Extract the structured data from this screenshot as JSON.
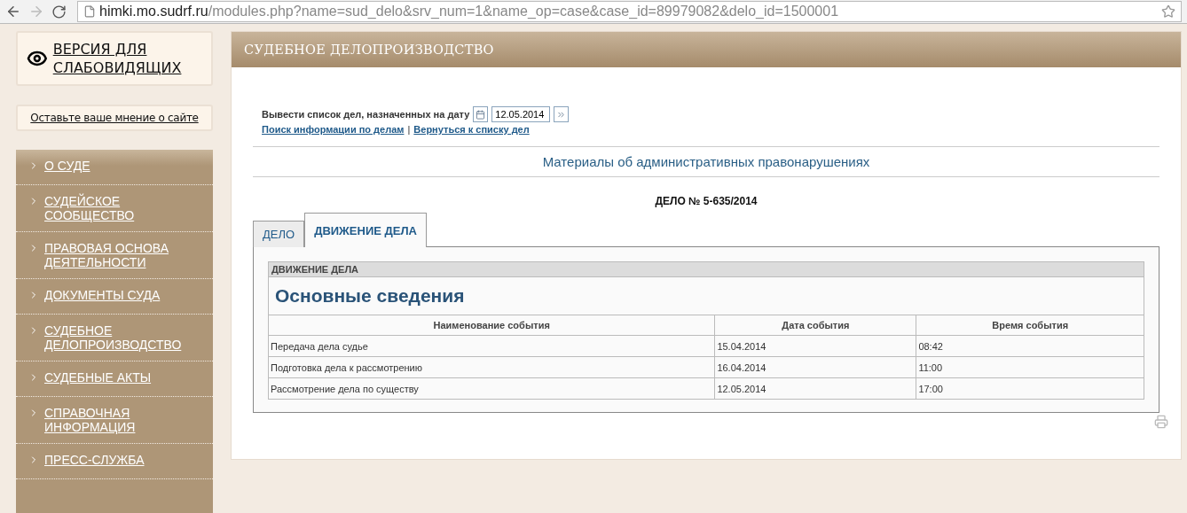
{
  "browser": {
    "url_host": "himki.mo.sudrf.ru",
    "url_path": "/modules.php?name=sud_delo&srv_num=1&name_op=case&case_id=89979082&delo_id=1500001"
  },
  "sidebar": {
    "accessibility_link": "ВЕРСИЯ ДЛЯ СЛАБОВИДЯЩИХ",
    "feedback_link": "Оставьте ваше мнение о сайте",
    "menu": [
      {
        "label": "О СУДЕ"
      },
      {
        "label": "СУДЕЙСКОЕ СООБЩЕСТВО"
      },
      {
        "label": "ПРАВОВАЯ ОСНОВА ДЕЯТЕЛЬНОСТИ"
      },
      {
        "label": "ДОКУМЕНТЫ СУДА"
      },
      {
        "label": "СУДЕБНОЕ ДЕЛОПРОИЗВОДСТВО"
      },
      {
        "label": "СУДЕБНЫЕ АКТЫ"
      },
      {
        "label": "СПРАВОЧНАЯ ИНФОРМАЦИЯ"
      },
      {
        "label": "ПРЕСС-СЛУЖБА"
      }
    ]
  },
  "main": {
    "header": "СУДЕБНОЕ ДЕЛОПРОИЗВОДСТВО",
    "form": {
      "label": "Вывести список дел, назначенных на дату",
      "date_value": "12.05.2014",
      "links": [
        "Поиск информации по делам",
        "Вернуться к списку дел"
      ],
      "separator": "|"
    },
    "category": "Материалы об административных правонарушениях",
    "case_title": "ДЕЛО № 5-635/2014",
    "tabs": [
      {
        "label": "ДЕЛО",
        "selected": false
      },
      {
        "label": "ДВИЖЕНИЕ ДЕЛА",
        "selected": true
      }
    ],
    "panel": {
      "section_header": "ДВИЖЕНИЕ ДЕЛА",
      "heading": "Основные сведения",
      "columns": [
        "Наименование события",
        "Дата события",
        "Время события"
      ],
      "rows": [
        [
          "Передача дела судье",
          "15.04.2014",
          "08:42"
        ],
        [
          "Подготовка дела к рассмотрению",
          "16.04.2014",
          "11:00"
        ],
        [
          "Рассмотрение дела по существу",
          "12.05.2014",
          "17:00"
        ]
      ]
    }
  }
}
